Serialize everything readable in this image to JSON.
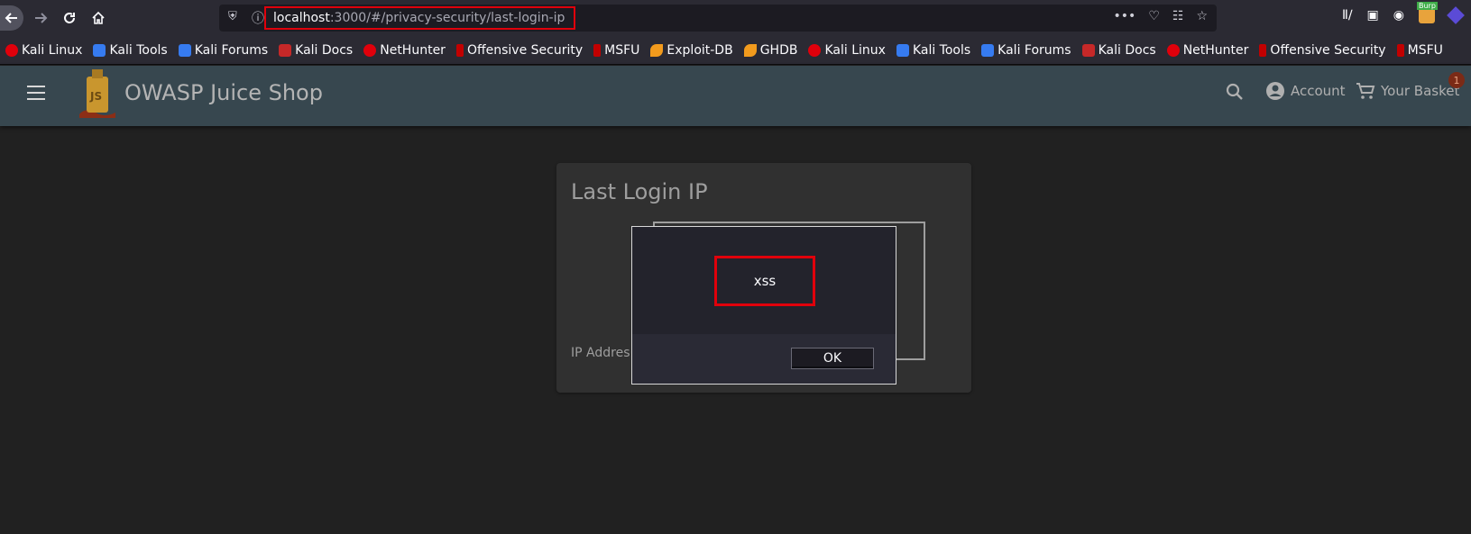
{
  "browser": {
    "url_host": "localhost",
    "url_path": ":3000/#/privacy-security/last-login-ip",
    "burp_label": "Burp"
  },
  "bookmarks": [
    {
      "label": "Kali Linux",
      "icon": "kali-icon"
    },
    {
      "label": "Kali Tools",
      "icon": "tools-icon"
    },
    {
      "label": "Kali Forums",
      "icon": "tools-icon"
    },
    {
      "label": "Kali Docs",
      "icon": "docs-icon"
    },
    {
      "label": "NetHunter",
      "icon": "kali-icon"
    },
    {
      "label": "Offensive Security",
      "icon": "offsec-icon"
    },
    {
      "label": "MSFU",
      "icon": "offsec-icon"
    },
    {
      "label": "Exploit-DB",
      "icon": "exploitdb-icon"
    },
    {
      "label": "GHDB",
      "icon": "exploitdb-icon"
    },
    {
      "label": "Kali Linux",
      "icon": "kali-icon"
    },
    {
      "label": "Kali Tools",
      "icon": "tools-icon"
    },
    {
      "label": "Kali Forums",
      "icon": "tools-icon"
    },
    {
      "label": "Kali Docs",
      "icon": "docs-icon"
    },
    {
      "label": "NetHunter",
      "icon": "kali-icon"
    },
    {
      "label": "Offensive Security",
      "icon": "offsec-icon"
    },
    {
      "label": "MSFU",
      "icon": "offsec-icon"
    }
  ],
  "app": {
    "title": "OWASP Juice Shop",
    "account_label": "Account",
    "basket_label": "Your Basket",
    "basket_count": "1"
  },
  "card": {
    "title": "Last Login IP",
    "label": "IP Addres"
  },
  "dialog": {
    "message": "xss",
    "ok_label": "OK"
  },
  "colors": {
    "highlight": "#e0000b",
    "header": "#37474f",
    "background": "#212121"
  }
}
